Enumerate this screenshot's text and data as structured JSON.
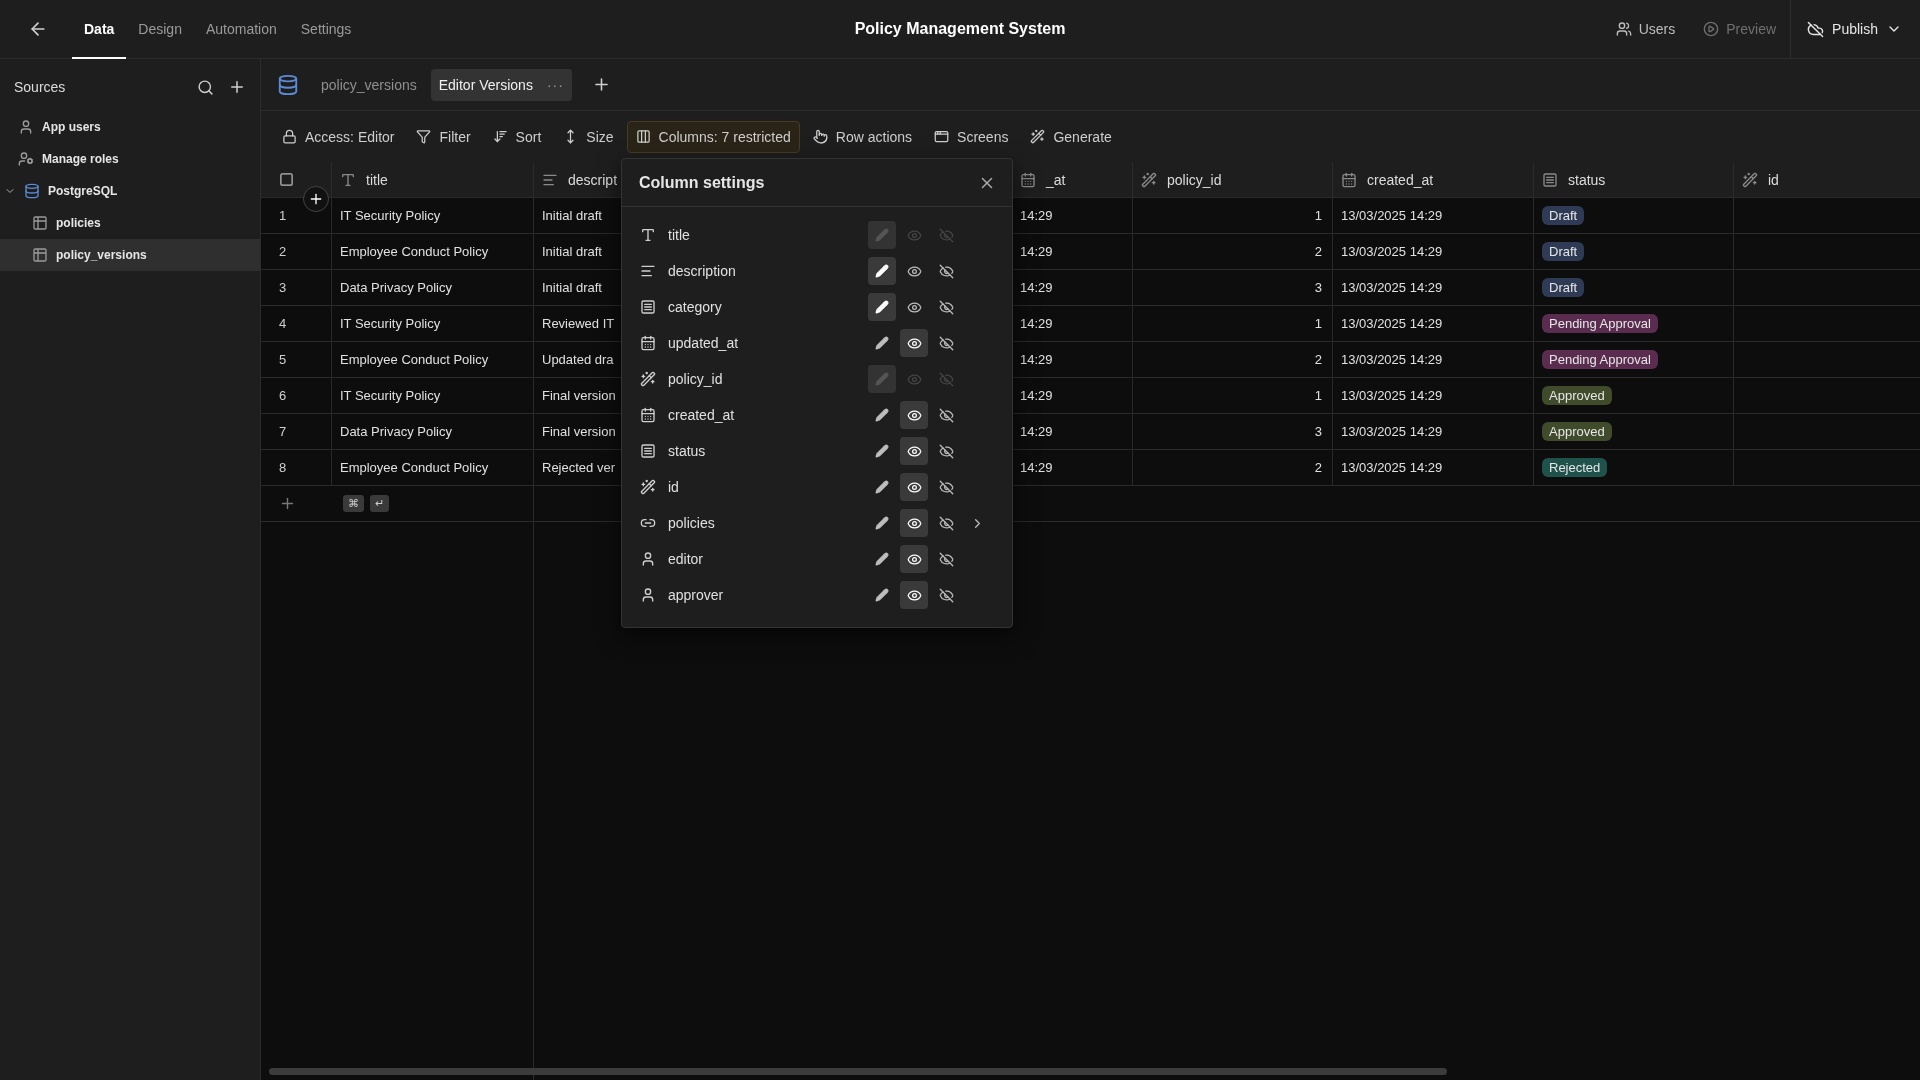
{
  "top_bar": {
    "nav_tabs": [
      {
        "label": "Data",
        "selected": true
      },
      {
        "label": "Design",
        "selected": false
      },
      {
        "label": "Automation",
        "selected": false
      },
      {
        "label": "Settings",
        "selected": false
      }
    ],
    "title": "Policy Management System",
    "actions": [
      {
        "kind": "users",
        "label": "Users",
        "disabled": false
      },
      {
        "kind": "preview",
        "label": "Preview",
        "disabled": true
      }
    ],
    "publish": {
      "label": "Publish"
    }
  },
  "sidebar": {
    "title": "Sources",
    "items": [
      {
        "kind": "users",
        "label": "App users",
        "selected": false
      },
      {
        "kind": "roles",
        "label": "Manage roles",
        "selected": false
      },
      {
        "kind": "database",
        "label": "PostgreSQL",
        "selected": false,
        "expanded": true,
        "children": [
          {
            "kind": "table",
            "label": "policies",
            "selected": false
          },
          {
            "kind": "table",
            "label": "policy_versions",
            "selected": true
          }
        ]
      }
    ]
  },
  "table_tabs": [
    {
      "label": "policy_versions",
      "selected": false
    },
    {
      "label": "Editor Versions",
      "selected": true,
      "menu": "···"
    }
  ],
  "toolbar": [
    {
      "kind": "lock",
      "label": "Access: Editor",
      "selected": false
    },
    {
      "kind": "filter",
      "label": "Filter",
      "selected": false
    },
    {
      "kind": "sort",
      "label": "Sort",
      "selected": false
    },
    {
      "kind": "size",
      "label": "Size",
      "selected": false
    },
    {
      "kind": "columns",
      "label": "Columns: 7 restricted",
      "selected": true
    },
    {
      "kind": "hand",
      "label": "Row actions",
      "selected": false
    },
    {
      "kind": "screens",
      "label": "Screens",
      "selected": false
    },
    {
      "kind": "wand",
      "label": "Generate",
      "selected": false
    }
  ],
  "table": {
    "select_all": {
      "checked": false
    },
    "columns": [
      {
        "kind": "text",
        "label": "title"
      },
      {
        "kind": "longform",
        "label": "descript"
      },
      {
        "kind": "datetime",
        "label": "_at"
      },
      {
        "kind": "auto",
        "label": "policy_id"
      },
      {
        "kind": "datetime",
        "label": "created_at"
      },
      {
        "kind": "options",
        "label": "status"
      },
      {
        "kind": "auto",
        "label": "id"
      }
    ],
    "rows": [
      {
        "number": "1",
        "cells": [
          "IT Security Policy",
          "Initial draft",
          "14:29",
          "1",
          "13/03/2025 14:29",
          {
            "label": "Draft",
            "color": "#2f3b55"
          }
        ]
      },
      {
        "number": "2",
        "cells": [
          "Employee Conduct Policy",
          "Initial draft",
          "14:29",
          "2",
          "13/03/2025 14:29",
          {
            "label": "Draft",
            "color": "#2f3b55"
          }
        ]
      },
      {
        "number": "3",
        "cells": [
          "Data Privacy Policy",
          "Initial draft",
          "14:29",
          "3",
          "13/03/2025 14:29",
          {
            "label": "Draft",
            "color": "#2f3b55"
          }
        ]
      },
      {
        "number": "4",
        "cells": [
          "IT Security Policy",
          "Reviewed IT",
          "14:29",
          "1",
          "13/03/2025 14:29",
          {
            "label": "Pending Approval",
            "color": "#5a2c50"
          }
        ]
      },
      {
        "number": "5",
        "cells": [
          "Employee Conduct Policy",
          "Updated dra",
          "14:29",
          "2",
          "13/03/2025 14:29",
          {
            "label": "Pending Approval",
            "color": "#5a2c50"
          }
        ]
      },
      {
        "number": "6",
        "cells": [
          "IT Security Policy",
          "Final version",
          "14:29",
          "1",
          "13/03/2025 14:29",
          {
            "label": "Approved",
            "color": "#3f4b2b"
          }
        ]
      },
      {
        "number": "7",
        "cells": [
          "Data Privacy Policy",
          "Final version",
          "14:29",
          "3",
          "13/03/2025 14:29",
          {
            "label": "Approved",
            "color": "#3f4b2b"
          }
        ]
      },
      {
        "number": "8",
        "cells": [
          "Employee Conduct Policy",
          "Rejected ver",
          "14:29",
          "2",
          "13/03/2025 14:29",
          {
            "label": "Rejected",
            "color": "#1f524b"
          }
        ]
      }
    ],
    "add_row_keys": [
      "⌘",
      "↵"
    ]
  },
  "column_settings": {
    "title": "Column settings",
    "fields": [
      {
        "kind": "text",
        "label": "title",
        "locked": true,
        "expandable": false
      },
      {
        "kind": "longform",
        "label": "description",
        "locked": false,
        "editable": true,
        "read_only": false,
        "expandable": false
      },
      {
        "kind": "options",
        "label": "category",
        "locked": false,
        "editable": true,
        "read_only": false,
        "expandable": false
      },
      {
        "kind": "datetime",
        "label": "updated_at",
        "locked": false,
        "editable": false,
        "read_only": true,
        "expandable": false
      },
      {
        "kind": "auto",
        "label": "policy_id",
        "locked": true,
        "expandable": false
      },
      {
        "kind": "datetime",
        "label": "created_at",
        "locked": false,
        "editable": false,
        "read_only": true,
        "expandable": false
      },
      {
        "kind": "options",
        "label": "status",
        "locked": false,
        "editable": false,
        "read_only": true,
        "expandable": false
      },
      {
        "kind": "auto",
        "label": "id",
        "locked": false,
        "editable": false,
        "read_only": true,
        "expandable": false
      },
      {
        "kind": "relationship",
        "label": "policies",
        "locked": false,
        "editable": false,
        "read_only": true,
        "expandable": true
      },
      {
        "kind": "user",
        "label": "editor",
        "locked": false,
        "editable": false,
        "read_only": true,
        "expandable": false
      },
      {
        "kind": "user",
        "label": "approver",
        "locked": false,
        "editable": false,
        "read_only": true,
        "expandable": false
      }
    ]
  }
}
